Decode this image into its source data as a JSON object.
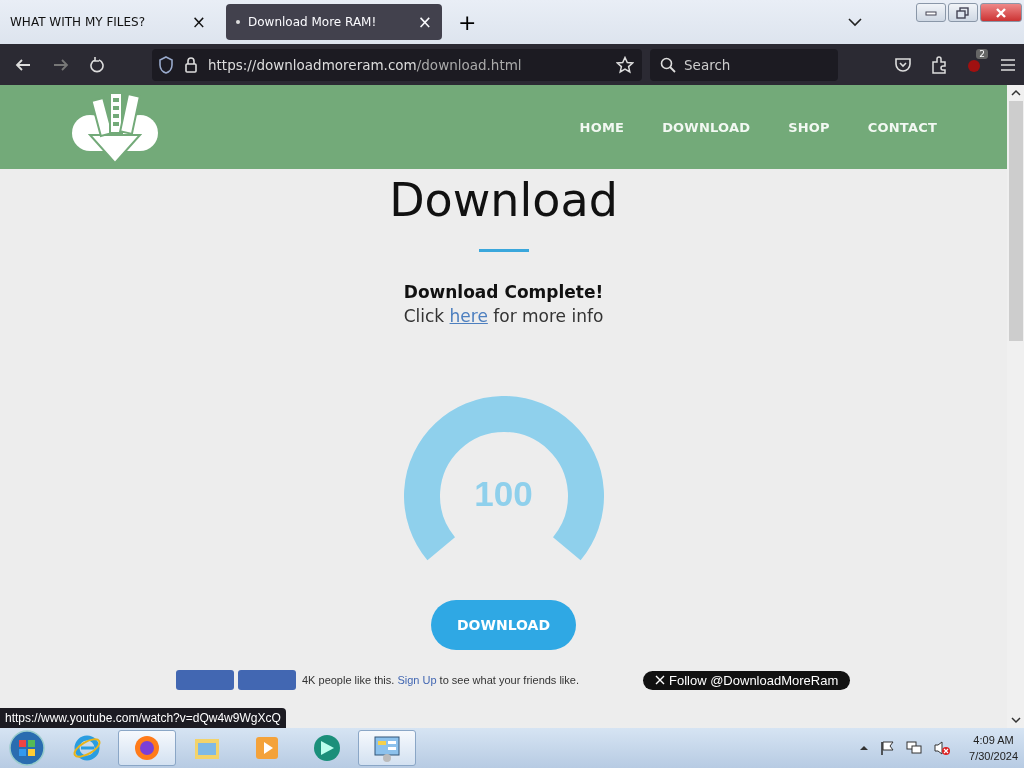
{
  "tabs": [
    {
      "label": "WHAT WITH MY FILES?",
      "selected": false,
      "close": "×"
    },
    {
      "label": "Download More RAM!",
      "selected": true,
      "close": "×"
    }
  ],
  "new_tab": "+",
  "toolbar": {
    "url_host": "https://downloadmoreram.com",
    "url_path": "/download.html",
    "search_placeholder": "Search",
    "extension_badge": "2"
  },
  "site": {
    "nav": [
      {
        "label": "HOME"
      },
      {
        "label": "DOWNLOAD"
      },
      {
        "label": "SHOP"
      },
      {
        "label": "CONTACT"
      }
    ],
    "heading": "Download",
    "status_title": "Download Complete!",
    "info_before": "Click ",
    "info_link": "here",
    "info_after": " for more info",
    "gauge": {
      "level": 1,
      "reading": "100"
    },
    "download_button": "DOWNLOAD",
    "social_text": "4K people like this.",
    "social_link": "Sign Up",
    "social_after": "to see what your friends like.",
    "follow_button": "Follow @DownloadMoreRam"
  },
  "status_url": "https://www.youtube.com/watch?v=dQw4w9WgXcQ",
  "taskbar": {
    "apps": [
      {
        "kind": "ie",
        "selected": false
      },
      {
        "kind": "firefox",
        "selected": true
      },
      {
        "kind": "folder",
        "selected": false
      },
      {
        "kind": "media",
        "selected": false
      },
      {
        "kind": "orb",
        "selected": false
      },
      {
        "kind": "panel",
        "selected": true
      }
    ],
    "time": "4:09 AM",
    "date": "7/30/2024"
  }
}
